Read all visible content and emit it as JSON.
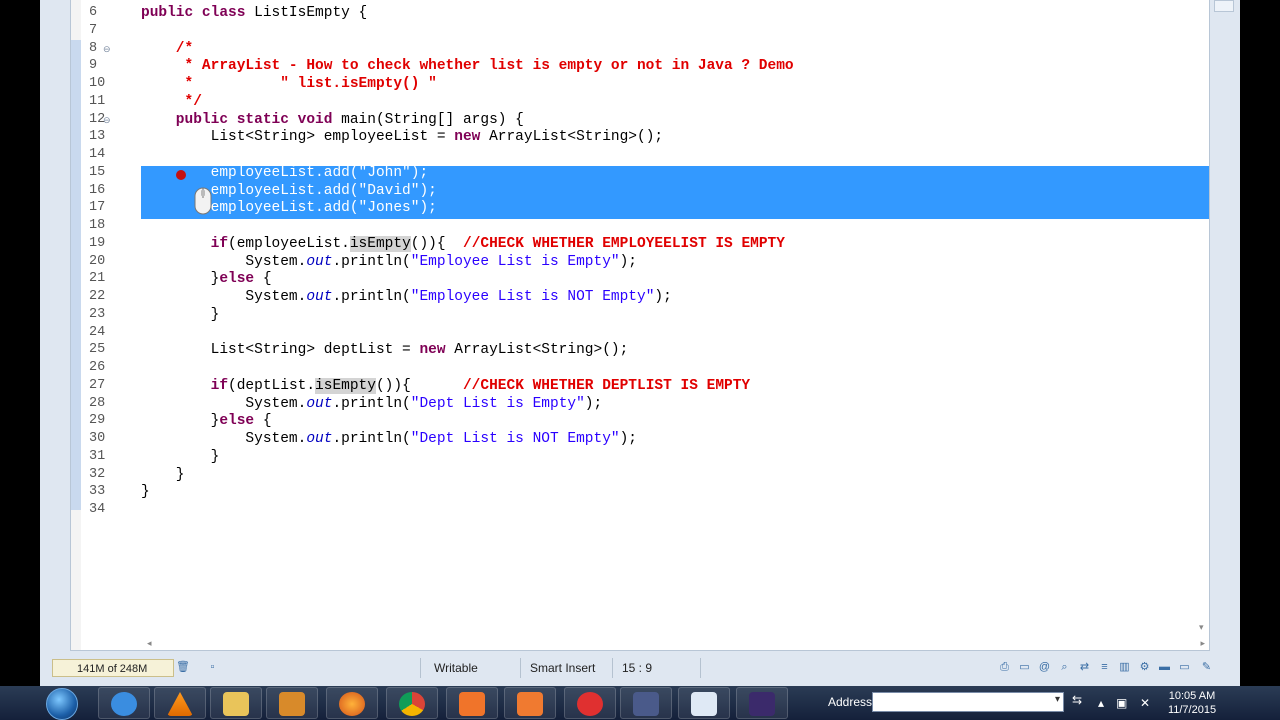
{
  "editor": {
    "lines": [
      {
        "num": "6",
        "segs": [
          {
            "t": "public class ",
            "c": "kw"
          },
          {
            "t": "ListIsEmpty {",
            "c": ""
          }
        ]
      },
      {
        "num": "7",
        "segs": []
      },
      {
        "num": "8",
        "fold": "⊖",
        "segs": [
          {
            "t": "    /*",
            "c": "cm"
          }
        ]
      },
      {
        "num": "9",
        "segs": [
          {
            "t": "     * ArrayList - How to check whether list is empty or not in Java ? Demo",
            "c": "cm"
          }
        ]
      },
      {
        "num": "10",
        "segs": [
          {
            "t": "     *          \" list.isEmpty() \"",
            "c": "cm"
          }
        ]
      },
      {
        "num": "11",
        "segs": [
          {
            "t": "     */",
            "c": "cm"
          }
        ]
      },
      {
        "num": "12",
        "fold": "⊖",
        "segs": [
          {
            "t": "    public static void ",
            "c": "kw"
          },
          {
            "t": "main(String[] args) {",
            "c": ""
          }
        ]
      },
      {
        "num": "13",
        "segs": [
          {
            "t": "        List<String> employeeList = ",
            "c": ""
          },
          {
            "t": "new ",
            "c": "kw"
          },
          {
            "t": "ArrayList<String>();",
            "c": ""
          }
        ]
      },
      {
        "num": "14",
        "segs": []
      },
      {
        "num": "15",
        "selected": true,
        "segs": [
          {
            "t": "        ",
            "c": ""
          },
          {
            "t": "employeeList.add(\"John\");",
            "c": "selected-text"
          }
        ]
      },
      {
        "num": "16",
        "selected": true,
        "segs": [
          {
            "t": "        ",
            "c": ""
          },
          {
            "t": "employeeList.add(\"David\");",
            "c": "selected-text"
          }
        ]
      },
      {
        "num": "17",
        "selected": true,
        "segs": [
          {
            "t": "        ",
            "c": ""
          },
          {
            "t": "employeeList.add(\"Jones\");",
            "c": "selected-text"
          }
        ]
      },
      {
        "num": "18",
        "segs": []
      },
      {
        "num": "19",
        "segs": [
          {
            "t": "        ",
            "c": ""
          },
          {
            "t": "if",
            "c": "kw"
          },
          {
            "t": "(employeeList.",
            "c": ""
          },
          {
            "t": "isEmpty",
            "c": "hl"
          },
          {
            "t": "()){  ",
            "c": ""
          },
          {
            "t": "//CHECK WHETHER EMPLOYEELIST IS EMPTY",
            "c": "cm"
          }
        ]
      },
      {
        "num": "20",
        "segs": [
          {
            "t": "            System.",
            "c": ""
          },
          {
            "t": "out",
            "c": "fld"
          },
          {
            "t": ".println(",
            "c": ""
          },
          {
            "t": "\"Employee List is Empty\"",
            "c": "str"
          },
          {
            "t": ");",
            "c": ""
          }
        ]
      },
      {
        "num": "21",
        "segs": [
          {
            "t": "        }",
            "c": ""
          },
          {
            "t": "else",
            "c": "kw"
          },
          {
            "t": " {",
            "c": ""
          }
        ]
      },
      {
        "num": "22",
        "segs": [
          {
            "t": "            System.",
            "c": ""
          },
          {
            "t": "out",
            "c": "fld"
          },
          {
            "t": ".println(",
            "c": ""
          },
          {
            "t": "\"Employee List is NOT Empty\"",
            "c": "str"
          },
          {
            "t": ");",
            "c": ""
          }
        ]
      },
      {
        "num": "23",
        "segs": [
          {
            "t": "        }",
            "c": ""
          }
        ]
      },
      {
        "num": "24",
        "segs": []
      },
      {
        "num": "25",
        "segs": [
          {
            "t": "        List<String> deptList = ",
            "c": ""
          },
          {
            "t": "new",
            "c": "kw"
          },
          {
            "t": " ArrayList<String>();",
            "c": ""
          }
        ]
      },
      {
        "num": "26",
        "segs": []
      },
      {
        "num": "27",
        "segs": [
          {
            "t": "        ",
            "c": ""
          },
          {
            "t": "if",
            "c": "kw"
          },
          {
            "t": "(deptList.",
            "c": ""
          },
          {
            "t": "isEmpty",
            "c": "hl"
          },
          {
            "t": "()){      ",
            "c": ""
          },
          {
            "t": "//CHECK WHETHER DEPTLIST IS EMPTY",
            "c": "cm"
          }
        ]
      },
      {
        "num": "28",
        "segs": [
          {
            "t": "            System.",
            "c": ""
          },
          {
            "t": "out",
            "c": "fld"
          },
          {
            "t": ".println(",
            "c": ""
          },
          {
            "t": "\"Dept List is Empty\"",
            "c": "str"
          },
          {
            "t": ");",
            "c": ""
          }
        ]
      },
      {
        "num": "29",
        "segs": [
          {
            "t": "        }",
            "c": ""
          },
          {
            "t": "else",
            "c": "kw"
          },
          {
            "t": " {",
            "c": ""
          }
        ]
      },
      {
        "num": "30",
        "segs": [
          {
            "t": "            System.",
            "c": ""
          },
          {
            "t": "out",
            "c": "fld"
          },
          {
            "t": ".println(",
            "c": ""
          },
          {
            "t": "\"Dept List is NOT Empty\"",
            "c": "str"
          },
          {
            "t": ");",
            "c": ""
          }
        ]
      },
      {
        "num": "31",
        "segs": [
          {
            "t": "        }",
            "c": ""
          }
        ]
      },
      {
        "num": "32",
        "segs": [
          {
            "t": "    }",
            "c": ""
          }
        ]
      },
      {
        "num": "33",
        "segs": [
          {
            "t": "}",
            "c": ""
          }
        ]
      },
      {
        "num": "34",
        "segs": []
      }
    ]
  },
  "status": {
    "memory": "141M of 248M",
    "writable": "Writable",
    "insert_mode": "Smart Insert",
    "position": "15 : 9"
  },
  "taskbar": {
    "address_label": "Address",
    "time": "10:05 AM",
    "date": "11/7/2015"
  },
  "colors": {
    "selection": "#3399ff",
    "keyword": "#7f0055",
    "comment": "#e00000",
    "string": "#2a00ff"
  }
}
